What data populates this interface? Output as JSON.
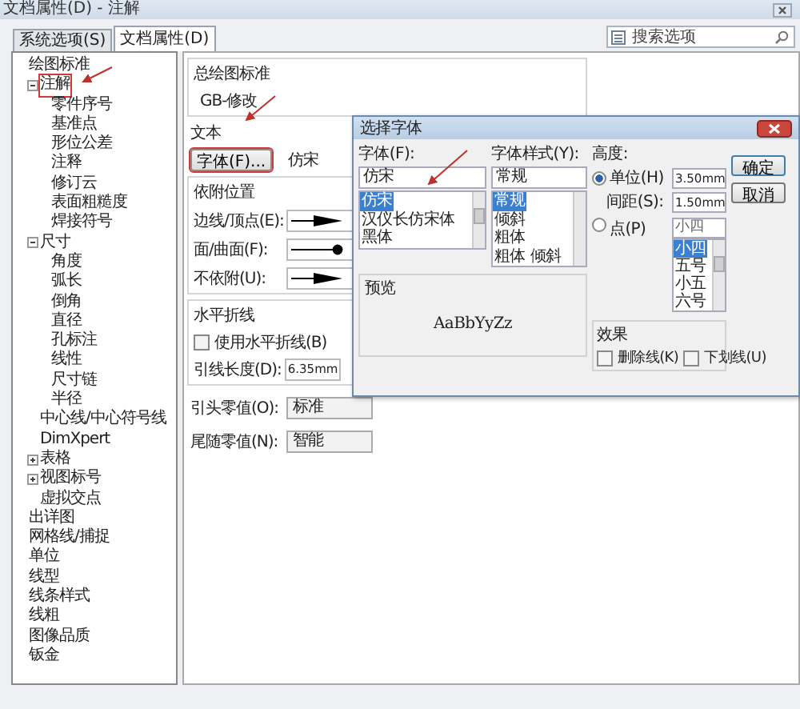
{
  "window": {
    "title": "文档属性(D) - 注解"
  },
  "tabs": [
    {
      "label": "系统选项(S)",
      "selected": false
    },
    {
      "label": "文档属性(D)",
      "selected": true
    }
  ],
  "search": {
    "placeholder": "搜索选项"
  },
  "tree": [
    {
      "label": "绘图标准",
      "children": [
        {
          "label": "注解",
          "expanded": true,
          "marked": true,
          "children": [
            {
              "label": "零件序号"
            },
            {
              "label": "基准点"
            },
            {
              "label": "形位公差"
            },
            {
              "label": "注释"
            },
            {
              "label": "修订云"
            },
            {
              "label": "表面粗糙度"
            },
            {
              "label": "焊接符号"
            }
          ]
        },
        {
          "label": "尺寸",
          "expanded": true,
          "children": [
            {
              "label": "角度"
            },
            {
              "label": "弧长"
            },
            {
              "label": "倒角"
            },
            {
              "label": "直径"
            },
            {
              "label": "孔标注"
            },
            {
              "label": "线性"
            },
            {
              "label": "尺寸链"
            },
            {
              "label": "半径"
            }
          ]
        },
        {
          "label": "中心线/中心符号线"
        },
        {
          "label": "DimXpert"
        },
        {
          "label": "表格",
          "expanded": false
        },
        {
          "label": "视图标号",
          "expanded": false
        },
        {
          "label": "虚拟交点"
        }
      ]
    },
    {
      "label": "出详图"
    },
    {
      "label": "网格线/捕捉"
    },
    {
      "label": "单位"
    },
    {
      "label": "线型"
    },
    {
      "label": "线条样式"
    },
    {
      "label": "线粗"
    },
    {
      "label": "图像品质"
    },
    {
      "label": "钣金"
    }
  ],
  "panel": {
    "standard": {
      "label": "总绘图标准",
      "value": "GB-修改"
    },
    "text": {
      "label": "文本",
      "font_button": "字体(F)...",
      "font_button_marked": true,
      "font": "仿宋"
    },
    "attach": {
      "label": "依附位置",
      "rows": [
        {
          "label": "边线/顶点(E):",
          "kind": "arrow"
        },
        {
          "label": "面/曲面(F):",
          "kind": "dot"
        },
        {
          "label": "不依附(U):",
          "kind": "arrow"
        }
      ]
    },
    "bent": {
      "label": "水平折线",
      "checkbox": {
        "label": "使用水平折线(B)",
        "checked": false
      },
      "length_label": "引线长度(D):",
      "length": "6.35mm"
    },
    "zeros": [
      {
        "label": "引头零值(O):",
        "value": "标准"
      },
      {
        "label": "尾随零值(N):",
        "value": "智能"
      }
    ]
  },
  "dialog": {
    "title": "选择字体",
    "font": {
      "label": "字体(F):",
      "value": "仿宋",
      "options": [
        {
          "label": "仿宋",
          "selected": true
        },
        {
          "label": "汉仪长仿宋体",
          "selected": false
        },
        {
          "label": "黑体",
          "selected": false
        }
      ]
    },
    "style": {
      "label": "字体样式(Y):",
      "value": "常规",
      "options": [
        {
          "label": "常规",
          "selected": true
        },
        {
          "label": "倾斜",
          "selected": false
        },
        {
          "label": "粗体",
          "selected": false
        },
        {
          "label": "粗体 倾斜",
          "selected": false
        }
      ]
    },
    "height": {
      "label": "高度:",
      "units": {
        "label": "单位(H)",
        "selected": true,
        "value": "3.50mm"
      },
      "spacing": {
        "label": "间距(S):",
        "value": "1.50mm"
      },
      "points": {
        "label": "点(P)",
        "selected": false,
        "value": "小四",
        "options": [
          {
            "label": "小四",
            "selected": true
          },
          {
            "label": "五号",
            "selected": false
          },
          {
            "label": "小五",
            "selected": false
          },
          {
            "label": "六号",
            "selected": false
          }
        ]
      }
    },
    "buttons": [
      "确定",
      "取消"
    ],
    "preview": {
      "label": "预览",
      "sample": "AaBbYyZz"
    },
    "effects": {
      "label": "效果",
      "options": [
        {
          "label": "删除线(K)",
          "checked": false
        },
        {
          "label": "下划线(U)",
          "checked": false
        }
      ]
    }
  }
}
